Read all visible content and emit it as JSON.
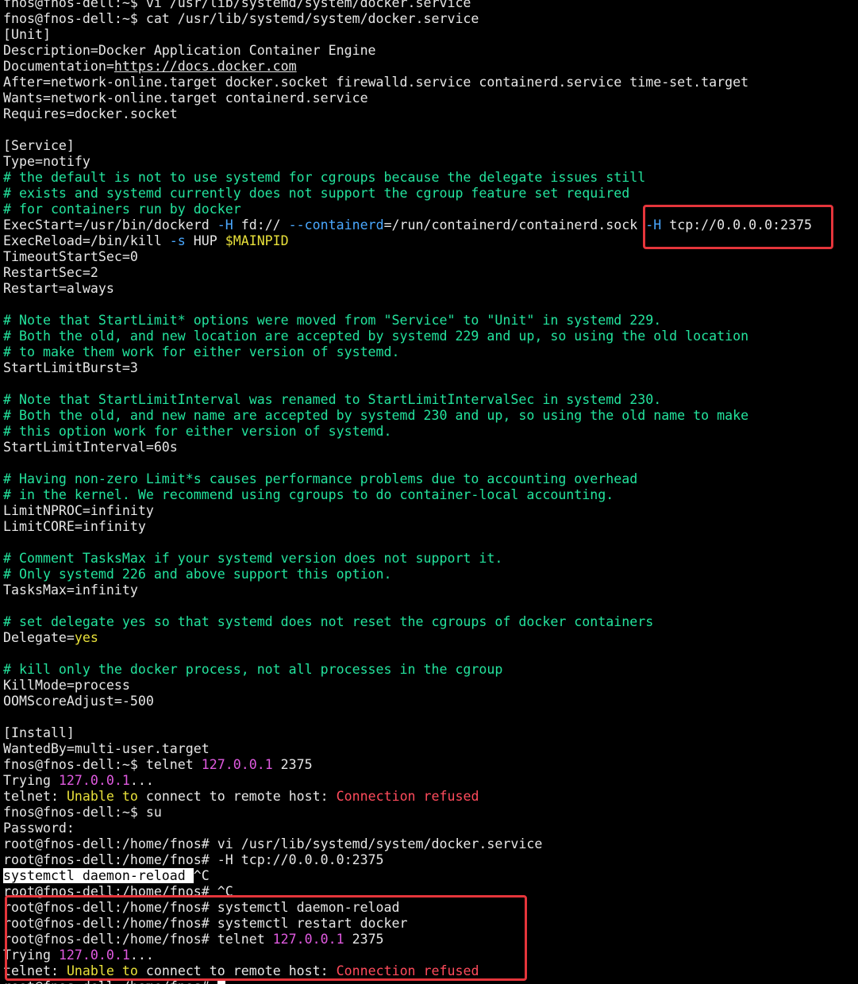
{
  "terminal": {
    "lines": [
      [
        {
          "t": "fnos@fnos-dell:~$ vi /usr/lib/systemd/system/docker.service"
        }
      ],
      [
        {
          "t": "fnos@fnos-dell:~$ cat /usr/lib/systemd/system/docker.service"
        }
      ],
      [
        {
          "t": "[Unit]"
        }
      ],
      [
        {
          "t": "Description=Docker Application Container Engine"
        }
      ],
      [
        {
          "t": "Documentation="
        },
        {
          "t": "https://docs.docker.com",
          "c": "link"
        }
      ],
      [
        {
          "t": "After=network-online.target docker.socket firewalld.service containerd.service time-set.target"
        }
      ],
      [
        {
          "t": "Wants=network-online.target containerd.service"
        }
      ],
      [
        {
          "t": "Requires=docker.socket"
        }
      ],
      [
        {
          "t": ""
        }
      ],
      [
        {
          "t": "[Service]"
        }
      ],
      [
        {
          "t": "Type=notify"
        }
      ],
      [
        {
          "t": "# the default is not to use systemd for cgroups because the delegate issues still",
          "c": "comment"
        }
      ],
      [
        {
          "t": "# exists and systemd currently does not support the cgroup feature set required",
          "c": "comment"
        }
      ],
      [
        {
          "t": "# for containers run by docker",
          "c": "comment"
        }
      ],
      [
        {
          "t": "ExecStart=/usr/bin/dockerd "
        },
        {
          "t": "-H",
          "c": "flag"
        },
        {
          "t": " fd:// "
        },
        {
          "t": "--containerd",
          "c": "flag"
        },
        {
          "t": "=/run/containerd/containerd.sock "
        },
        {
          "t": "-H",
          "c": "flag"
        },
        {
          "t": " tcp://0.0.0.0:2375"
        }
      ],
      [
        {
          "t": "ExecReload=/bin/kill "
        },
        {
          "t": "-s",
          "c": "flag"
        },
        {
          "t": " HUP "
        },
        {
          "t": "$MAINPID",
          "c": "var"
        }
      ],
      [
        {
          "t": "TimeoutStartSec=0"
        }
      ],
      [
        {
          "t": "RestartSec=2"
        }
      ],
      [
        {
          "t": "Restart=always"
        }
      ],
      [
        {
          "t": ""
        }
      ],
      [
        {
          "t": "# Note that StartLimit* options were moved from \"Service\" to \"Unit\" in systemd 229.",
          "c": "comment"
        }
      ],
      [
        {
          "t": "# Both the old, and new location are accepted by systemd 229 and up, so using the old location",
          "c": "comment"
        }
      ],
      [
        {
          "t": "# to make them work for either version of systemd.",
          "c": "comment"
        }
      ],
      [
        {
          "t": "StartLimitBurst=3"
        }
      ],
      [
        {
          "t": ""
        }
      ],
      [
        {
          "t": "# Note that StartLimitInterval was renamed to StartLimitIntervalSec in systemd 230.",
          "c": "comment"
        }
      ],
      [
        {
          "t": "# Both the old, and new name are accepted by systemd 230 and up, so using the old name to make",
          "c": "comment"
        }
      ],
      [
        {
          "t": "# this option work for either version of systemd.",
          "c": "comment"
        }
      ],
      [
        {
          "t": "StartLimitInterval=60s"
        }
      ],
      [
        {
          "t": ""
        }
      ],
      [
        {
          "t": "# Having non-zero Limit*s causes performance problems due to accounting overhead",
          "c": "comment"
        }
      ],
      [
        {
          "t": "# in the kernel. We recommend using cgroups to do container-local accounting.",
          "c": "comment"
        }
      ],
      [
        {
          "t": "LimitNPROC=infinity"
        }
      ],
      [
        {
          "t": "LimitCORE=infinity"
        }
      ],
      [
        {
          "t": ""
        }
      ],
      [
        {
          "t": "# Comment TasksMax if your systemd version does not support it.",
          "c": "comment"
        }
      ],
      [
        {
          "t": "# Only systemd 226 and above support this option.",
          "c": "comment"
        }
      ],
      [
        {
          "t": "TasksMax=infinity"
        }
      ],
      [
        {
          "t": ""
        }
      ],
      [
        {
          "t": "# set delegate yes so that systemd does not reset the cgroups of docker containers",
          "c": "comment"
        }
      ],
      [
        {
          "t": "Delegate="
        },
        {
          "t": "yes",
          "c": "var"
        }
      ],
      [
        {
          "t": ""
        }
      ],
      [
        {
          "t": "# kill only the docker process, not all processes in the cgroup",
          "c": "comment"
        }
      ],
      [
        {
          "t": "KillMode=process"
        }
      ],
      [
        {
          "t": "OOMScoreAdjust=-500"
        }
      ],
      [
        {
          "t": ""
        }
      ],
      [
        {
          "t": "[Install]"
        }
      ],
      [
        {
          "t": "WantedBy=multi-user.target"
        }
      ],
      [
        {
          "t": "fnos@fnos-dell:~$ telnet "
        },
        {
          "t": "127.0.0.1",
          "c": "num"
        },
        {
          "t": " 2375"
        }
      ],
      [
        {
          "t": "Trying "
        },
        {
          "t": "127.0.0.1",
          "c": "num"
        },
        {
          "t": "..."
        }
      ],
      [
        {
          "t": "telnet: "
        },
        {
          "t": "Unable",
          "c": "warn"
        },
        {
          "t": " "
        },
        {
          "t": "to",
          "c": "warn"
        },
        {
          "t": " connect to remote host: "
        },
        {
          "t": "Connection refused",
          "c": "err"
        }
      ],
      [
        {
          "t": "fnos@fnos-dell:~$ su"
        }
      ],
      [
        {
          "t": "Password:"
        }
      ],
      [
        {
          "t": "root@fnos-dell:/home/fnos# vi /usr/lib/systemd/system/docker.service"
        }
      ],
      [
        {
          "t": "root@fnos-dell:/home/fnos# -H tcp://0.0.0.0:2375"
        }
      ],
      [
        {
          "t": "systemctl daemon-reload ",
          "c": "hl"
        },
        {
          "t": "^C"
        }
      ],
      [
        {
          "t": "root@fnos-dell:/home/fnos# ^C"
        }
      ],
      [
        {
          "t": "root@fnos-dell:/home/fnos# systemctl daemon-reload"
        }
      ],
      [
        {
          "t": "root@fnos-dell:/home/fnos# systemctl restart docker"
        }
      ],
      [
        {
          "t": "root@fnos-dell:/home/fnos# telnet "
        },
        {
          "t": "127.0.0.1",
          "c": "num"
        },
        {
          "t": " 2375"
        }
      ],
      [
        {
          "t": "Trying "
        },
        {
          "t": "127.0.0.1",
          "c": "num"
        },
        {
          "t": "..."
        }
      ],
      [
        {
          "t": "telnet: "
        },
        {
          "t": "Unable",
          "c": "warn"
        },
        {
          "t": " "
        },
        {
          "t": "to",
          "c": "warn"
        },
        {
          "t": " connect to remote host: "
        },
        {
          "t": "Connection refused",
          "c": "err"
        }
      ],
      [
        {
          "t": "root@fnos-dell:/home/fnos# "
        },
        {
          "t": " ",
          "c": "cursor"
        }
      ]
    ]
  },
  "colors": {
    "background": "#000000",
    "text": "#e6e6e6",
    "comment": "#23e39d",
    "flag": "#4aa8ff",
    "variable": "#e8e03a",
    "number": "#e05ae0",
    "error": "#ff4b5c",
    "annotation_box": "#e5353b"
  }
}
